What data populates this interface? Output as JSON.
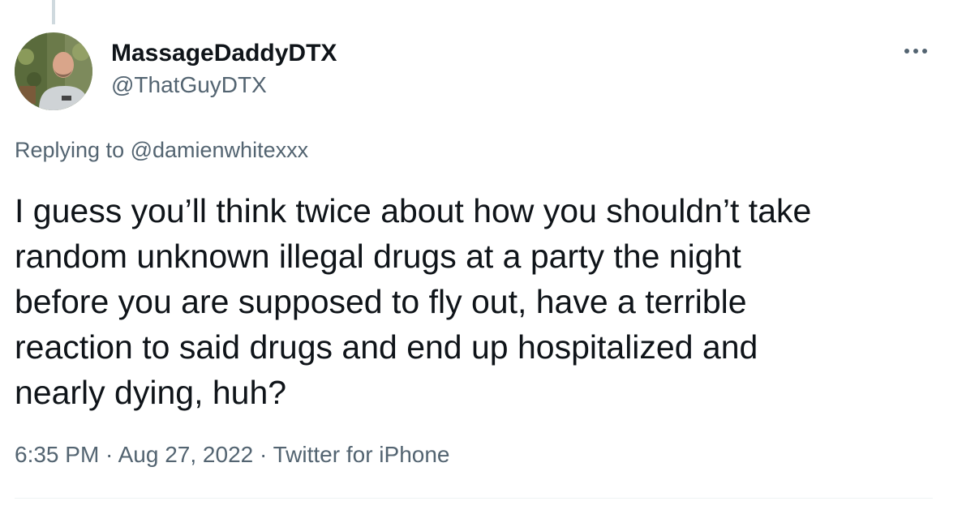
{
  "tweet": {
    "display_name": "MassageDaddyDTX",
    "handle": "@ThatGuyDTX",
    "replying_prefix": "Replying to ",
    "replying_to": "@damienwhitexxx",
    "text": "I guess you’ll think twice about how you shouldn’t take\nrandom unknown illegal drugs at a party the night\nbefore you are supposed to fly out, have a terrible\nreaction to said drugs and end up hospitalized and\nnearly dying, huh?",
    "time": "6:35 PM",
    "separator": " · ",
    "date": "Aug 27, 2022",
    "source": "Twitter for iPhone"
  },
  "icons": {
    "more": "more-horizontal-icon",
    "avatar": "profile-avatar"
  },
  "colors": {
    "text_primary": "#0f1419",
    "text_secondary": "#536471",
    "thread_line": "#cfd9de",
    "divider": "#eff3f4"
  }
}
